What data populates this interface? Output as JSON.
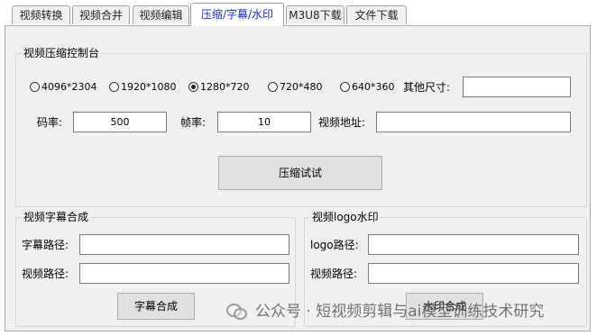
{
  "tabs": [
    {
      "label": "视频转换"
    },
    {
      "label": "视频合并"
    },
    {
      "label": "视频编辑"
    },
    {
      "label": "压缩/字幕/水印"
    },
    {
      "label": "M3U8下载"
    },
    {
      "label": "文件下载"
    }
  ],
  "active_tab": "压缩/字幕/水印",
  "compress": {
    "title": "视频压缩控制台",
    "resolutions": [
      {
        "label": "4096*2304",
        "selected": false
      },
      {
        "label": "1920*1080",
        "selected": false
      },
      {
        "label": "1280*720",
        "selected": true
      },
      {
        "label": "720*480",
        "selected": false
      },
      {
        "label": "640*360",
        "selected": false
      }
    ],
    "other_size_label": "其他尺寸:",
    "other_size_value": "",
    "bitrate_label": "码率:",
    "bitrate_value": "500",
    "framerate_label": "帧率:",
    "framerate_value": "10",
    "video_path_label": "视频地址:",
    "video_path_value": "",
    "button": "压缩试试"
  },
  "subtitle": {
    "title": "视频字幕合成",
    "subtitle_path_label": "字幕路径:",
    "subtitle_path_value": "",
    "video_path_label": "视频路径:",
    "video_path_value": "",
    "button": "字幕合成"
  },
  "logo": {
    "title": "视频logo水印",
    "logo_path_label": "logo路径:",
    "logo_path_value": "",
    "video_path_label": "视频路径:",
    "video_path_value": "",
    "button": "水印合成"
  },
  "watermark": {
    "text": "公众号 · 短视频剪辑与ai模型训练技术研究",
    "icon": "wechat-icon"
  }
}
